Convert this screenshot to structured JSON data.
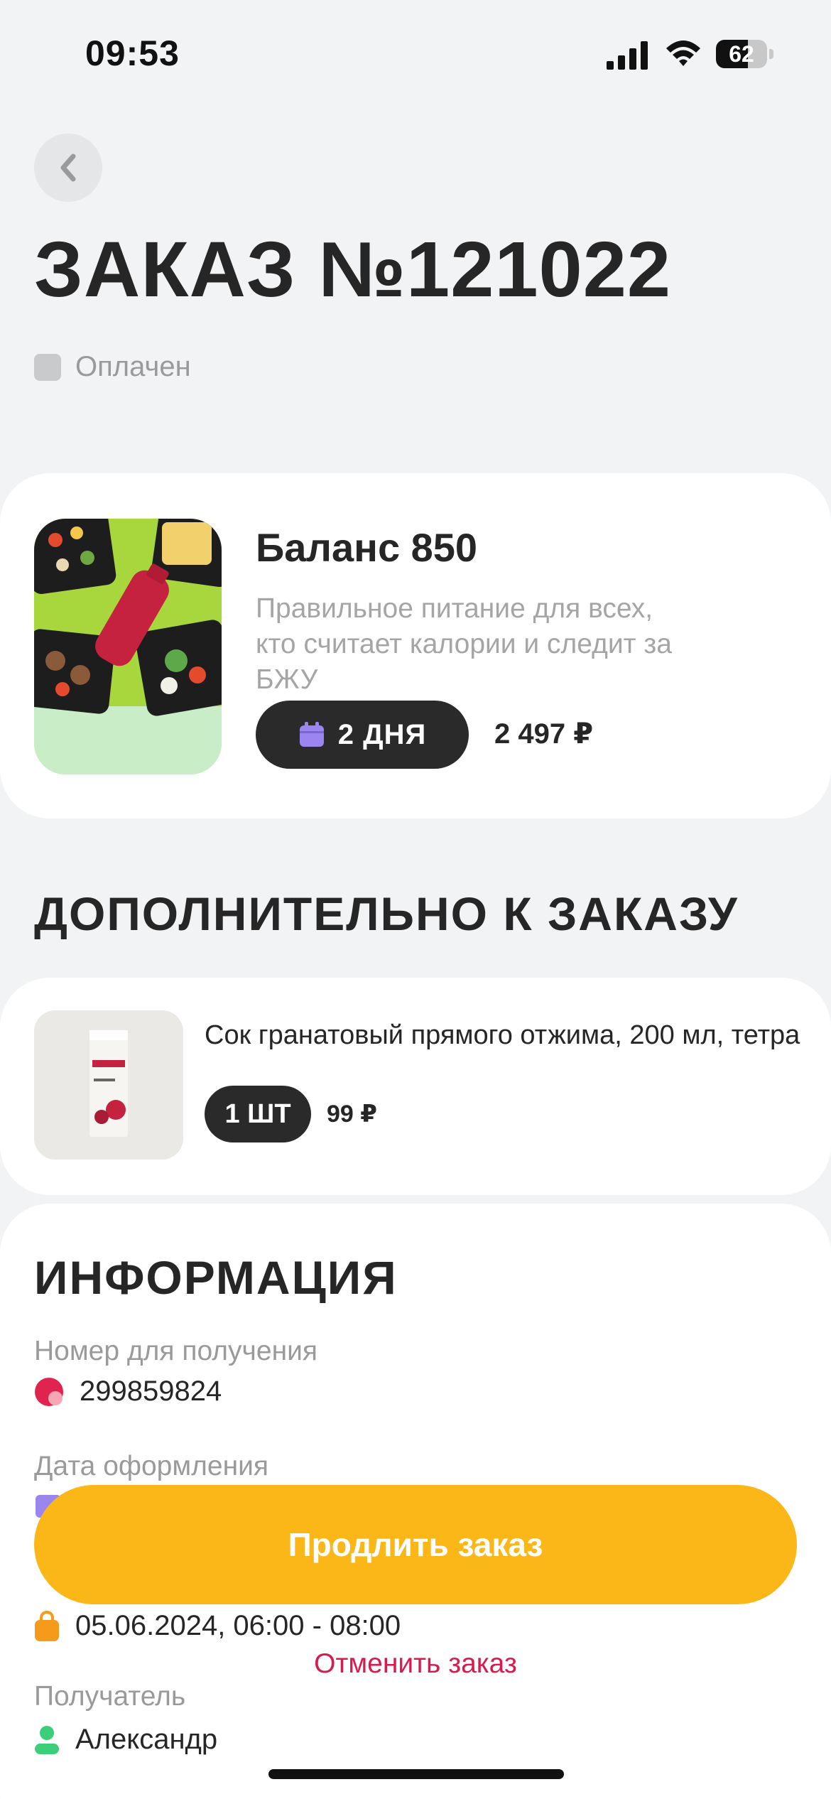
{
  "status_bar": {
    "time": "09:53",
    "battery": "62",
    "battery_level": 0.62,
    "icons": [
      "signal-icon",
      "wifi-icon",
      "battery-icon"
    ]
  },
  "header": {
    "back_icon": "chevron-left-icon",
    "title": "ЗАКАЗ №121022",
    "status": "Оплачен"
  },
  "product": {
    "name": "Баланс 850",
    "description": "Правильное питание для всех, кто считает калории и следит за БЖУ",
    "days_label": "2 ДНЯ",
    "days_icon": "calendar-icon",
    "price": "2 497 ₽"
  },
  "additional": {
    "title": "ДОПОЛНИТЕЛЬНО К ЗАКАЗУ",
    "items": [
      {
        "name": "Сок гранатовый прямого отжима, 200 мл, тетра",
        "quantity": "1 ШТ",
        "price": "99 ₽"
      }
    ]
  },
  "info": {
    "title": "ИНФОРМАЦИЯ",
    "rows": [
      {
        "label": "Номер для получения",
        "value": "299859824",
        "icon": "number-icon"
      },
      {
        "label": "Дата оформления",
        "value": "",
        "icon": "calendar-icon"
      },
      {
        "label": "",
        "value": "05.06.2024, 06:00 - 08:00",
        "icon": "bag-icon"
      },
      {
        "label": "Получатель",
        "value": "Александр",
        "icon": "user-icon"
      }
    ]
  },
  "actions": {
    "extend_label": "Продлить заказ",
    "cancel_label": "Отменить заказ"
  },
  "colors": {
    "accent": "#fbb617",
    "cancel": "#d81b4f",
    "dark": "#2a2a2a",
    "background": "#f2f3f5"
  }
}
